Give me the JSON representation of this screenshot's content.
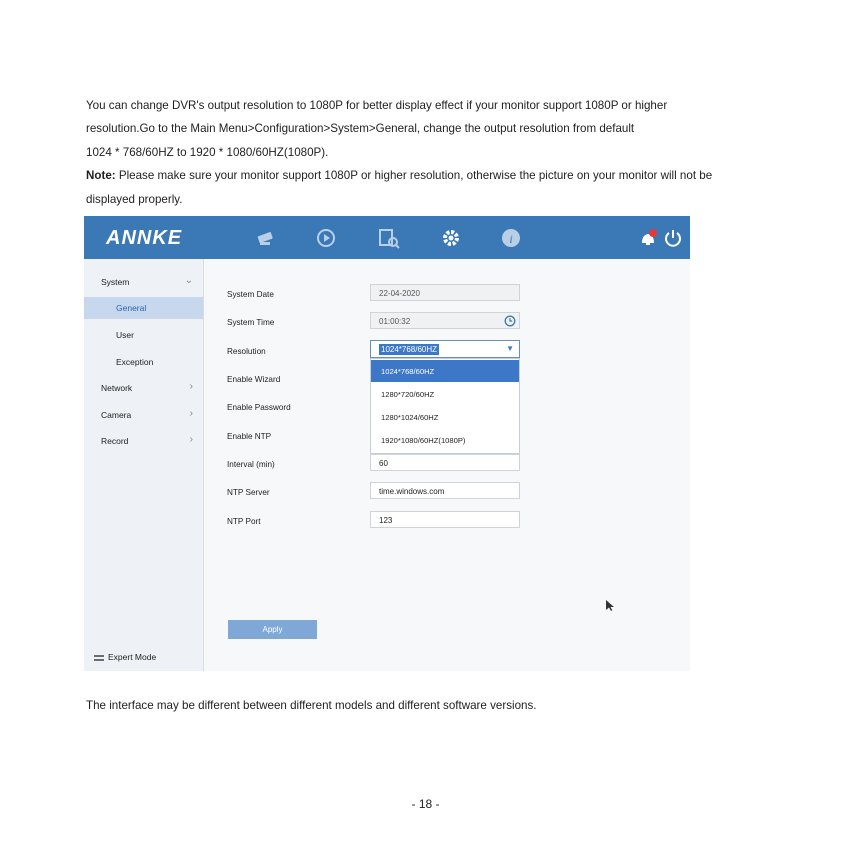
{
  "intro": {
    "line1": "You can change DVR's output resolution to 1080P for better display effect if your monitor support 1080P or higher",
    "line2": "resolution.Go to the Main Menu>Configuration>System>General, change the output resolution from default",
    "line3": "1024 * 768/60HZ to 1920 * 1080/60HZ(1080P).",
    "note_label": "Note:",
    "note_text": " Please make sure your monitor support 1080P or higher resolution, otherwise the picture on your monitor will not be",
    "note_text2": "displayed properly."
  },
  "dvr": {
    "logo": "ANNKE",
    "colors": {
      "topbar": "#3a78b6",
      "selection": "#3d78c8",
      "notification": "#e53935"
    },
    "topbar_icons": [
      "camera-icon",
      "playback-icon",
      "search-icon",
      "settings-icon",
      "info-icon",
      "bell-icon",
      "power-icon"
    ],
    "sidebar": {
      "system": "System",
      "general": "General",
      "user": "User",
      "exception": "Exception",
      "network": "Network",
      "camera": "Camera",
      "record": "Record",
      "expert_mode": "Expert Mode"
    },
    "form": {
      "system_date_label": "System Date",
      "system_date_value": "22-04-2020",
      "system_time_label": "System Time",
      "system_time_value": "01:00:32",
      "resolution_label": "Resolution",
      "resolution_value": "1024*768/60HZ",
      "enable_wizard_label": "Enable Wizard",
      "enable_password_label": "Enable Password",
      "enable_ntp_label": "Enable NTP",
      "interval_label": "Interval (min)",
      "interval_value": "60",
      "ntp_server_label": "NTP Server",
      "ntp_server_value": "time.windows.com",
      "ntp_port_label": "NTP Port",
      "ntp_port_value": "123",
      "apply_label": "Apply"
    },
    "resolution_options": [
      "1024*768/60HZ",
      "1280*720/60HZ",
      "1280*1024/60HZ",
      "1920*1080/60HZ(1080P)"
    ]
  },
  "footer": "The interface may be different between different models and different software versions.",
  "page_number": "- 18 -"
}
